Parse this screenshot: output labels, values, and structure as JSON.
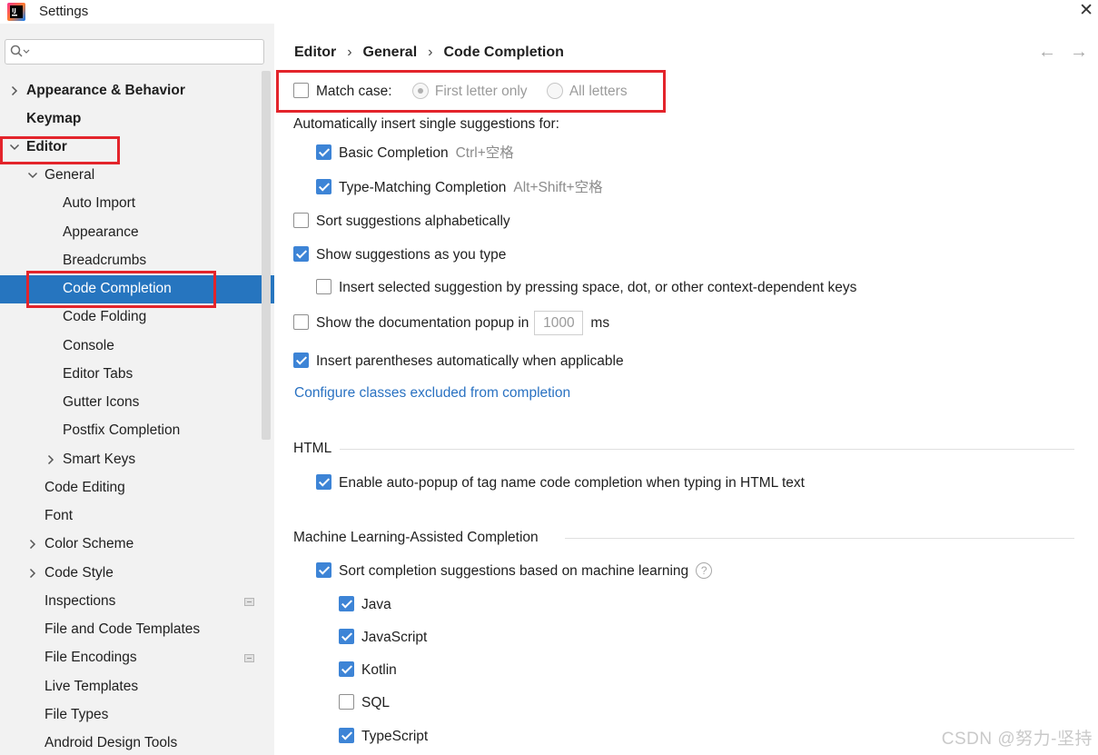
{
  "window": {
    "title": "Settings",
    "close_glyph": "✕",
    "app_icon": "intellij-logo-icon"
  },
  "search": {
    "placeholder": "",
    "icon": "search-icon"
  },
  "sidebar": {
    "items": [
      {
        "label": "Appearance & Behavior"
      },
      {
        "label": "Keymap"
      },
      {
        "label": "Editor"
      },
      {
        "label": "General"
      },
      {
        "label": "Auto Import"
      },
      {
        "label": "Appearance"
      },
      {
        "label": "Breadcrumbs"
      },
      {
        "label": "Code Completion"
      },
      {
        "label": "Code Folding"
      },
      {
        "label": "Console"
      },
      {
        "label": "Editor Tabs"
      },
      {
        "label": "Gutter Icons"
      },
      {
        "label": "Postfix Completion"
      },
      {
        "label": "Smart Keys"
      },
      {
        "label": "Code Editing"
      },
      {
        "label": "Font"
      },
      {
        "label": "Color Scheme"
      },
      {
        "label": "Code Style"
      },
      {
        "label": "Inspections"
      },
      {
        "label": "File and Code Templates"
      },
      {
        "label": "File Encodings"
      },
      {
        "label": "Live Templates"
      },
      {
        "label": "File Types"
      },
      {
        "label": "Android Design Tools"
      }
    ],
    "selected": "Code Completion"
  },
  "breadcrumb": {
    "items": [
      "Editor",
      "General",
      "Code Completion"
    ],
    "separator": "›"
  },
  "nav": {
    "back": "←",
    "forward": "→"
  },
  "main": {
    "match_case": {
      "label": "Match case:",
      "checked": false,
      "option1": "First letter only",
      "option2": "All letters"
    },
    "auto_insert_label": "Automatically insert single suggestions for:",
    "basic_completion": {
      "label": "Basic Completion",
      "shortcut": "Ctrl+空格",
      "checked": true
    },
    "type_matching": {
      "label": "Type-Matching Completion",
      "shortcut": "Alt+Shift+空格",
      "checked": true
    },
    "sort_alpha": {
      "label": "Sort suggestions alphabetically",
      "checked": false
    },
    "show_suggestions": {
      "label": "Show suggestions as you type",
      "checked": true
    },
    "insert_selected": {
      "label": "Insert selected suggestion by pressing space, dot, or other context-dependent keys",
      "checked": false
    },
    "doc_popup": {
      "label": "Show the documentation popup in",
      "value": "1000",
      "unit": "ms",
      "checked": false
    },
    "insert_parens": {
      "label": "Insert parentheses automatically when applicable",
      "checked": true
    },
    "configure_link": "Configure classes excluded from completion",
    "html_section": {
      "title": "HTML",
      "auto_popup": {
        "label": "Enable auto-popup of tag name code completion when typing in HTML text",
        "checked": true
      }
    },
    "ml_section": {
      "title": "Machine Learning-Assisted Completion",
      "sort_ml": {
        "label": "Sort completion suggestions based on machine learning",
        "checked": true
      },
      "languages": [
        {
          "label": "Java",
          "checked": true
        },
        {
          "label": "JavaScript",
          "checked": true
        },
        {
          "label": "Kotlin",
          "checked": true
        },
        {
          "label": "SQL",
          "checked": false
        },
        {
          "label": "TypeScript",
          "checked": true
        }
      ]
    }
  },
  "watermark": "CSDN @努力-坚持",
  "colors": {
    "selection": "#2675bf",
    "checkbox_on": "#3d84d6",
    "highlight_border": "#e3242b",
    "link": "#2a72c2"
  }
}
